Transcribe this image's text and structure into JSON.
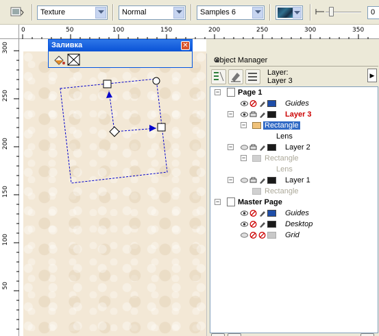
{
  "propbar": {
    "fill_type": "Texture",
    "merge_mode": "Normal",
    "texture_library": "Samples 6",
    "transparency_value": "0"
  },
  "ruler": {
    "h_labels": [
      "0",
      "50",
      "100",
      "150",
      "200",
      "250",
      "300",
      "350"
    ],
    "v_labels": [
      "300",
      "250",
      "200",
      "150",
      "100",
      "50"
    ]
  },
  "fill_toolbar": {
    "title": "Заливка"
  },
  "object_manager": {
    "title": "Object Manager",
    "layer_label": "Layer:",
    "layer_name": "Layer 3",
    "tree": [
      {
        "label": "Page 1",
        "level": 0
      },
      {
        "label": "Guides",
        "level": 1
      },
      {
        "label": "Layer 3",
        "level": 1
      },
      {
        "label": "Rectangle",
        "level": 2
      },
      {
        "label": "Lens",
        "level": 3
      },
      {
        "label": "Layer 2",
        "level": 1
      },
      {
        "label": "Rectangle",
        "level": 2
      },
      {
        "label": "Lens",
        "level": 3
      },
      {
        "label": "Layer 1",
        "level": 1
      },
      {
        "label": "Rectangle",
        "level": 2
      },
      {
        "label": "Master Page",
        "level": 0
      },
      {
        "label": "Guides",
        "level": 1
      },
      {
        "label": "Desktop",
        "level": 1
      },
      {
        "label": "Grid",
        "level": 1
      }
    ]
  },
  "colors": {
    "layer3_red": "#cc0000",
    "selection_blue": "#316ac5",
    "guides_blue": "#1f4ea8",
    "rectangle_tan": "#f0c27a"
  }
}
